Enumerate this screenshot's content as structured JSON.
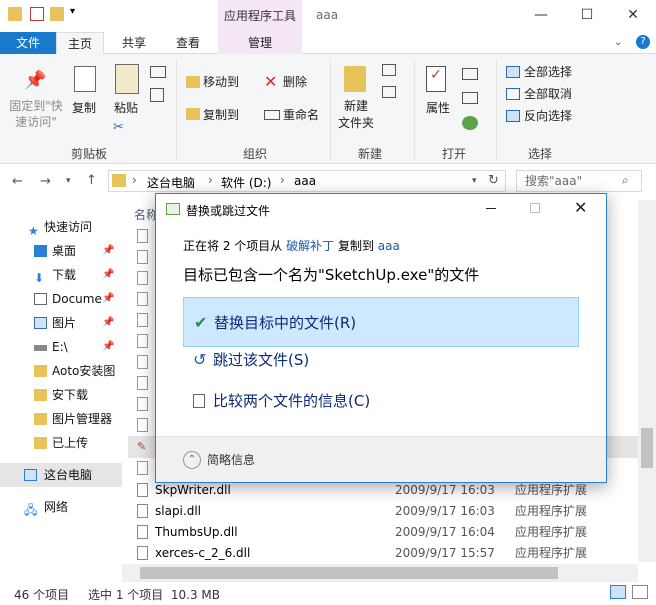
{
  "window": {
    "title": "aaa",
    "context_tab": "应用程序工具",
    "context_sub": "管理"
  },
  "tabs": [
    "文件",
    "主页",
    "共享",
    "查看"
  ],
  "ribbon": {
    "pin": "固定到\"快速访问\"",
    "copy": "复制",
    "paste": "粘贴",
    "clipboard": "剪贴板",
    "move_to": "移动到",
    "copy_to": "复制到",
    "delete": "删除",
    "rename": "重命名",
    "organize": "组织",
    "new_folder": "新建\n文件夹",
    "new_folder_1": "新建",
    "new_folder_2": "文件夹",
    "new_group": "新建",
    "properties": "属性",
    "open_group": "打开",
    "select_all": "全部选择",
    "select_none": "全部取消",
    "invert": "反向选择",
    "select_group": "选择"
  },
  "address": {
    "root": "这台电脑",
    "drive": "软件 (D:)",
    "folder": "aaa"
  },
  "search": {
    "placeholder": "搜索\"aaa\""
  },
  "nav": [
    {
      "label": "快速访问"
    },
    {
      "label": "桌面"
    },
    {
      "label": "下载"
    },
    {
      "label": "Docume"
    },
    {
      "label": "图片"
    },
    {
      "label": "E:\\"
    },
    {
      "label": "Aoto安装图"
    },
    {
      "label": "安下载"
    },
    {
      "label": "图片管理器"
    },
    {
      "label": "已上传"
    },
    {
      "label": "这台电脑"
    },
    {
      "label": "网络"
    }
  ],
  "list_header": {
    "name": "名称"
  },
  "files": [
    {
      "name": "SkpWriter.dll",
      "date": "2009/9/17 16:03",
      "type": "应用程序扩展"
    },
    {
      "name": "slapi.dll",
      "date": "2009/9/17 16:03",
      "type": "应用程序扩展"
    },
    {
      "name": "ThumbsUp.dll",
      "date": "2009/9/17 16:04",
      "type": "应用程序扩展"
    },
    {
      "name": "xerces-c_2_6.dll",
      "date": "2009/9/17 15:57",
      "type": "应用程序扩展"
    }
  ],
  "status": {
    "count": "46 个项目",
    "selected": "选中 1 个项目  10.3 MB"
  },
  "dialog": {
    "title": "替换或跳过文件",
    "line1_a": "正在将 2 个项目从",
    "line1_src": "破解补丁",
    "line1_b": "复制到",
    "line1_dst": "aaa",
    "heading": "目标已包含一个名为\"SketchUp.exe\"的文件",
    "opt_replace": "替换目标中的文件(R)",
    "opt_skip": "跳过该文件(S)",
    "opt_compare": "比较两个文件的信息(C)",
    "details": "简略信息"
  },
  "colors": {
    "accent": "#1979ca",
    "selected": "#cde8ff",
    "link": "#1e5aa8"
  }
}
